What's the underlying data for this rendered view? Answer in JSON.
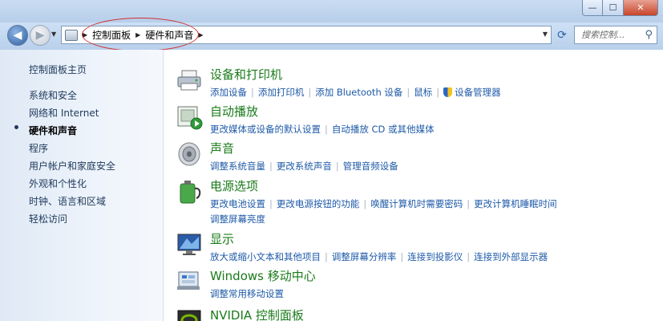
{
  "window": {
    "controls": {
      "minimize": "—",
      "maximize": "☐",
      "close": "✕"
    }
  },
  "navigation": {
    "back_glyph": "◀",
    "forward_glyph": "▶",
    "breadcrumbs": [
      "控制面板",
      "硬件和声音"
    ],
    "search_placeholder": "搜索控制..."
  },
  "sidebar": {
    "items": [
      {
        "label": "控制面板主页"
      },
      {
        "label": "系统和安全"
      },
      {
        "label": "网络和 Internet"
      },
      {
        "label": "硬件和声音"
      },
      {
        "label": "程序"
      },
      {
        "label": "用户帐户和家庭安全"
      },
      {
        "label": "外观和个性化"
      },
      {
        "label": "时钟、语言和区域"
      },
      {
        "label": "轻松访问"
      }
    ],
    "active": "硬件和声音"
  },
  "categories": [
    {
      "title": "设备和打印机",
      "icon": "printer-icon",
      "links": [
        "添加设备",
        "添加打印机",
        "添加 Bluetooth 设备",
        "鼠标",
        "设备管理器"
      ]
    },
    {
      "title": "自动播放",
      "icon": "autoplay-icon",
      "links": [
        "更改媒体或设备的默认设置",
        "自动播放 CD 或其他媒体"
      ]
    },
    {
      "title": "声音",
      "icon": "speaker-icon",
      "links": [
        "调整系统音量",
        "更改系统声音",
        "管理音频设备"
      ]
    },
    {
      "title": "电源选项",
      "icon": "battery-icon",
      "links": [
        "更改电池设置",
        "更改电源按钮的功能",
        "唤醒计算机时需要密码",
        "更改计算机睡眠时间",
        "调整屏幕亮度"
      ]
    },
    {
      "title": "显示",
      "icon": "display-icon",
      "links": [
        "放大或缩小文本和其他项目",
        "调整屏幕分辨率",
        "连接到投影仪",
        "连接到外部显示器"
      ]
    },
    {
      "title": "Windows 移动中心",
      "icon": "mobility-center-icon",
      "links": [
        "调整常用移动设置"
      ]
    },
    {
      "title": "NVIDIA 控制面板",
      "icon": "nvidia-icon",
      "links": []
    }
  ],
  "colors": {
    "category_title": "#1a7b1a",
    "link": "#1e5aa8",
    "annotation": "#d22d2d"
  }
}
